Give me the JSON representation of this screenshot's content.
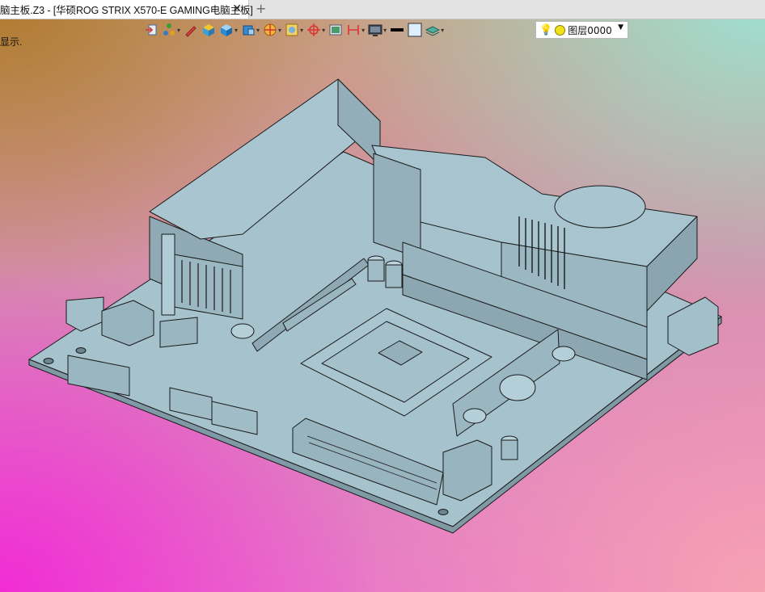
{
  "tab": {
    "title": "脑主板.Z3 - [华硕ROG STRIX X570-E GAMING电脑主板]",
    "close": "✕",
    "add": "+"
  },
  "status": {
    "text": "显示."
  },
  "toolbar": {
    "icons": [
      "import-icon",
      "tree-icon",
      "pen-icon",
      "box-icon",
      "cube-icon",
      "cube-view-icon",
      "target-icon",
      "render-icon",
      "axis-icon",
      "frame-icon",
      "dimension-icon",
      "monitor-icon",
      "line-style-icon",
      "color-icon",
      "layer-icon"
    ],
    "layer_label": "图层0000",
    "layer_icon": "bulb-icon",
    "colors": {
      "layer_dot": "#f2e21a",
      "line_swatch": "#000000",
      "fill_swatch": "#ddeeff"
    }
  },
  "model": {
    "name": "华硕ROG STRIX X570-E GAMING电脑主板",
    "colors": {
      "board": "#a2bfc9",
      "edge": "#1a1a1a"
    }
  }
}
